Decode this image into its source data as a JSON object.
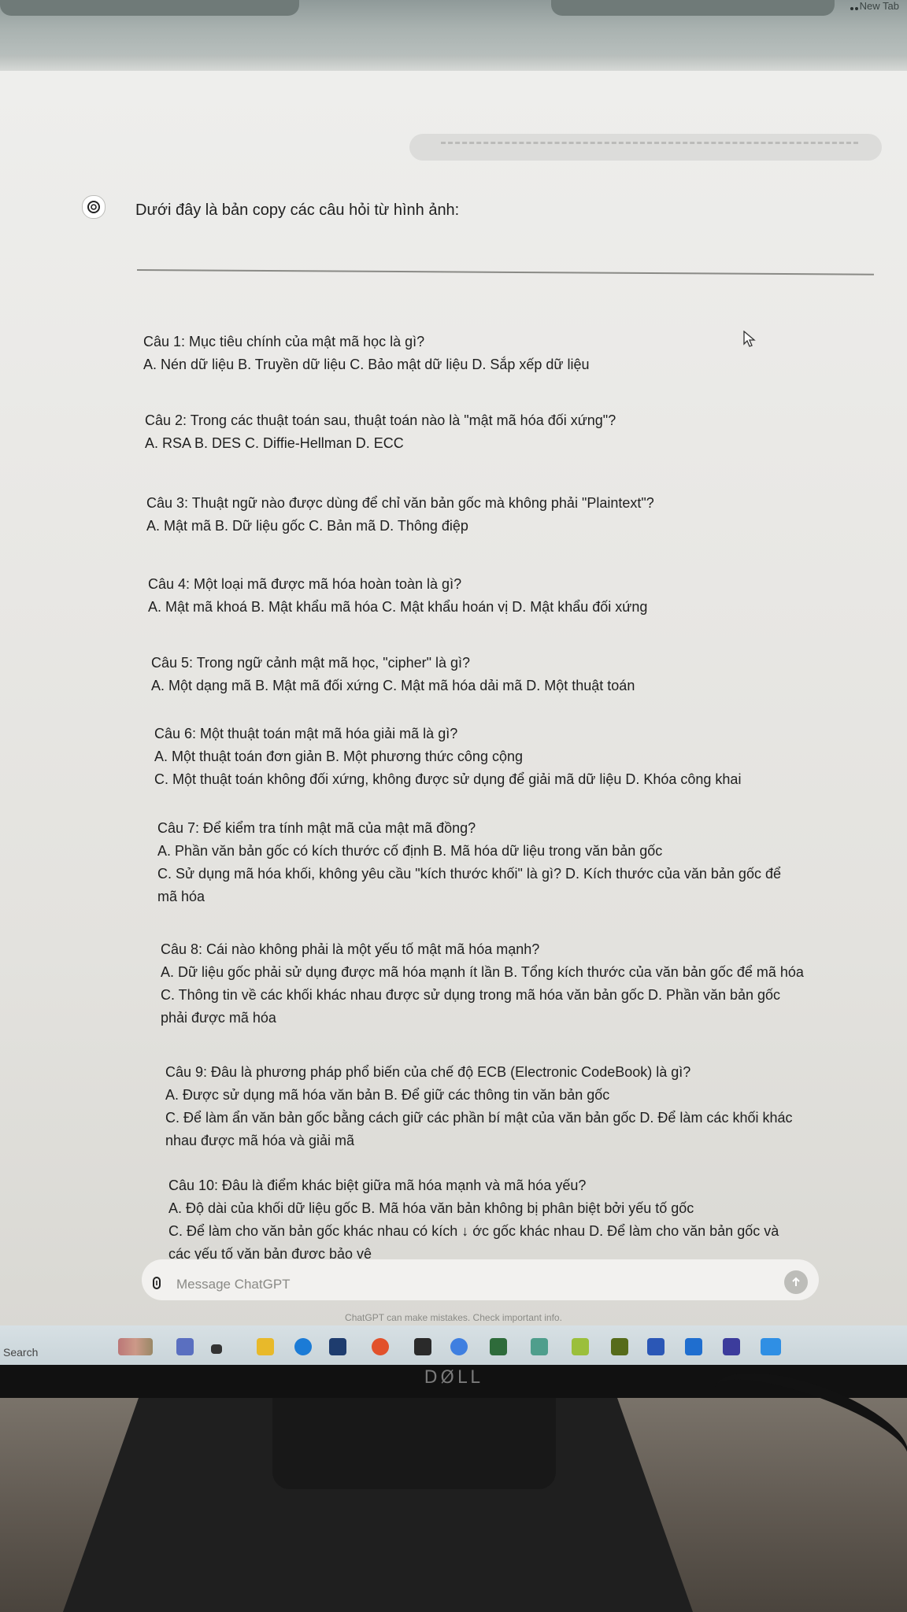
{
  "browser": {
    "new_tab": "New Tab"
  },
  "assistant": {
    "intro": "Dưới đây là bản copy các câu hỏi từ hình ảnh:",
    "questions": [
      {
        "title": "Câu 1: Mục tiêu chính của mật mã học là gì?",
        "options": [
          "A. Nén dữ liệu B. Truyền dữ liệu C. Bảo mật dữ liệu D. Sắp xếp dữ liệu"
        ]
      },
      {
        "title": "Câu 2: Trong các thuật toán sau, thuật toán nào là \"mật mã hóa đối xứng\"?",
        "options": [
          "A. RSA B. DES C. Diffie-Hellman D. ECC"
        ]
      },
      {
        "title": "Câu 3: Thuật ngữ nào được dùng để chỉ văn bản gốc mà không phải \"Plaintext\"?",
        "options": [
          "A. Mật mã B. Dữ liệu gốc C. Bản mã D. Thông điệp"
        ]
      },
      {
        "title": "Câu 4: Một loại mã được mã hóa hoàn toàn là gì?",
        "options": [
          "A. Mật mã khoá B. Mật khẩu mã hóa C. Mật khẩu hoán vị D. Mật khẩu đối xứng"
        ]
      },
      {
        "title": "Câu 5: Trong ngữ cảnh mật mã học, \"cipher\" là gì?",
        "options": [
          "A. Một dạng mã B. Mật mã đối xứng C. Mật mã hóa dải mã D. Một thuật toán"
        ]
      },
      {
        "title": "Câu 6: Một thuật toán mật mã hóa giải mã là gì?",
        "options": [
          "A. Một thuật toán đơn giản B. Một phương thức công cộng",
          "C. Một thuật toán không đối xứng, không được sử dụng để giải mã dữ liệu D. Khóa công khai"
        ]
      },
      {
        "title": "Câu 7: Để kiểm tra tính mật mã của mật mã đồng?",
        "options": [
          "A. Phần văn bản gốc có kích thước cố định B. Mã hóa dữ liệu trong văn bản gốc",
          "C. Sử dụng mã hóa khối, không yêu cầu \"kích thước khối\" là gì? D. Kích thước của văn bản gốc để",
          "mã hóa"
        ]
      },
      {
        "title": "Câu 8: Cái nào không phải là một yếu tố mật mã hóa mạnh?",
        "options": [
          "A. Dữ liệu gốc phải sử dụng được mã hóa mạnh ít lần B. Tổng kích thước của văn bản gốc để mã hóa",
          "C. Thông tin về các khối khác nhau được sử dụng trong mã hóa văn bản gốc D. Phần văn bản gốc",
          "phải được mã hóa"
        ]
      },
      {
        "title": "Câu 9: Đâu là phương pháp phổ biến của chế độ ECB (Electronic CodeBook) là gì?",
        "options": [
          "A. Được sử dụng mã hóa văn bản B. Để giữ các thông tin văn bản gốc",
          "C. Để làm ẩn văn bản gốc bằng cách giữ các phần bí mật của văn bản gốc D. Để làm các khối khác",
          "nhau được mã hóa và giải mã"
        ]
      },
      {
        "title": "Câu 10: Đâu là điểm khác biệt giữa mã hóa mạnh và mã hóa yếu?",
        "options": [
          "A. Độ dài của khối dữ liệu gốc B. Mã hóa văn bản không bị phân biệt bởi yếu tố gốc",
          "C. Để làm cho văn bản gốc khác nhau có kích ↓ ớc gốc khác nhau D. Để làm cho văn bản gốc và",
          "các yếu tố văn bản được bảo vệ"
        ]
      }
    ]
  },
  "composer": {
    "placeholder": "Message ChatGPT"
  },
  "disclaimer": "ChatGPT can make mistakes. Check important info.",
  "taskbar": {
    "search": "Search"
  },
  "monitor_brand": "DØLL",
  "colors": {
    "text": "#1f1f1f",
    "send": "#bdbdb9",
    "taskbar": "#cfd8dc"
  }
}
